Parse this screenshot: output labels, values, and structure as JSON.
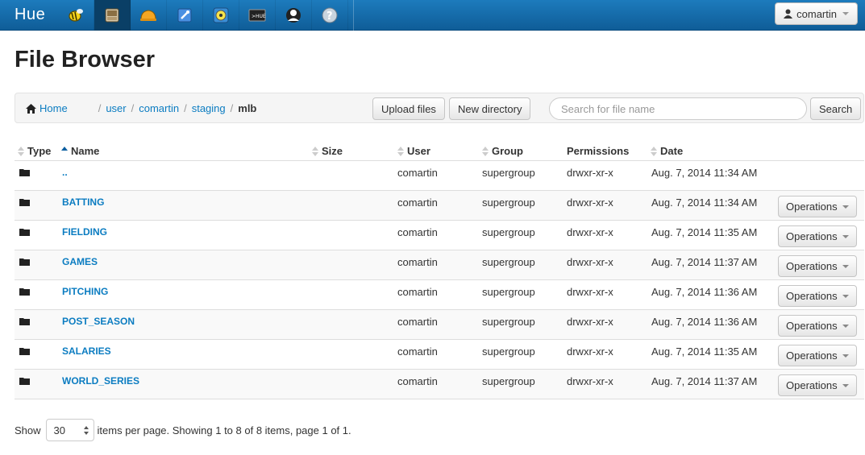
{
  "navbar": {
    "brand": "Hue",
    "icons": [
      "hue-bee-icon",
      "file-browser-icon",
      "job-browser-icon",
      "job-designer-icon",
      "oozie-icon",
      "shell-icon",
      "user-admin-icon",
      "help-icon"
    ],
    "user": "comartin"
  },
  "page": {
    "title": "File Browser"
  },
  "breadcrumb": {
    "home": "Home",
    "parts": [
      "user",
      "comartin",
      "staging"
    ],
    "current": "mlb"
  },
  "toolbar": {
    "upload_label": "Upload files",
    "new_dir_label": "New directory",
    "search_placeholder": "Search for file name",
    "search_label": "Search"
  },
  "table": {
    "headers": {
      "type": "Type",
      "name": "Name",
      "size": "Size",
      "user": "User",
      "group": "Group",
      "permissions": "Permissions",
      "date": "Date"
    },
    "rows": [
      {
        "name": "..",
        "size": "",
        "user": "comartin",
        "group": "supergroup",
        "permissions": "drwxr-xr-x",
        "date": "Aug. 7, 2014 11:34 AM",
        "ops": ""
      },
      {
        "name": "BATTING",
        "size": "",
        "user": "comartin",
        "group": "supergroup",
        "permissions": "drwxr-xr-x",
        "date": "Aug. 7, 2014 11:34 AM",
        "ops": "Operations"
      },
      {
        "name": "FIELDING",
        "size": "",
        "user": "comartin",
        "group": "supergroup",
        "permissions": "drwxr-xr-x",
        "date": "Aug. 7, 2014 11:35 AM",
        "ops": "Operations"
      },
      {
        "name": "GAMES",
        "size": "",
        "user": "comartin",
        "group": "supergroup",
        "permissions": "drwxr-xr-x",
        "date": "Aug. 7, 2014 11:37 AM",
        "ops": "Operations"
      },
      {
        "name": "PITCHING",
        "size": "",
        "user": "comartin",
        "group": "supergroup",
        "permissions": "drwxr-xr-x",
        "date": "Aug. 7, 2014 11:36 AM",
        "ops": "Operations"
      },
      {
        "name": "POST_SEASON",
        "size": "",
        "user": "comartin",
        "group": "supergroup",
        "permissions": "drwxr-xr-x",
        "date": "Aug. 7, 2014 11:36 AM",
        "ops": "Operations"
      },
      {
        "name": "SALARIES",
        "size": "",
        "user": "comartin",
        "group": "supergroup",
        "permissions": "drwxr-xr-x",
        "date": "Aug. 7, 2014 11:35 AM",
        "ops": "Operations"
      },
      {
        "name": "WORLD_SERIES",
        "size": "",
        "user": "comartin",
        "group": "supergroup",
        "permissions": "drwxr-xr-x",
        "date": "Aug. 7, 2014 11:37 AM",
        "ops": "Operations"
      }
    ]
  },
  "pager": {
    "show_label": "Show",
    "per_page": "30",
    "summary": "items per page. Showing 1 to 8 of 8 items, page 1 of 1."
  },
  "colors": {
    "navbar": "#1568a8",
    "link": "#0b7cc1",
    "sort_active": "#0b5fa0"
  }
}
